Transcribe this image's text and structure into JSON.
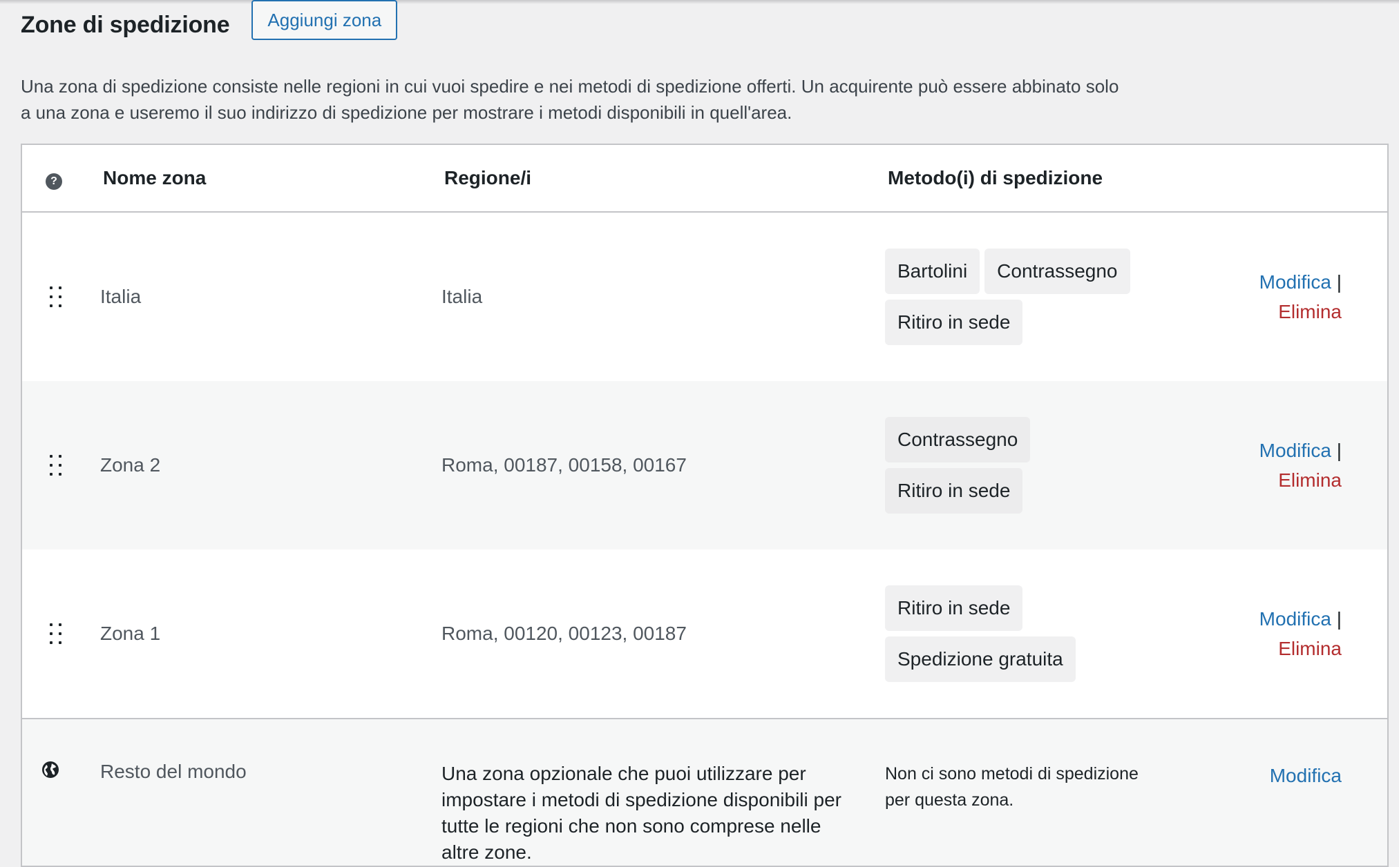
{
  "header": {
    "title": "Zone di spedizione",
    "add_zone_label": "Aggiungi zona"
  },
  "description": "Una zona di spedizione consiste nelle regioni in cui vuoi spedire e nei metodi di spedizione offerti. Un acquirente può essere abbinato solo a una zona e useremo il suo indirizzo di spedizione per mostrare i metodi disponibili in quell'area.",
  "table": {
    "help_icon": "?",
    "columns": {
      "name": "Nome zona",
      "regions": "Regione/i",
      "methods": "Metodo(i) di spedizione"
    },
    "rows": [
      {
        "name": "Italia",
        "regions": "Italia",
        "methods": [
          "Bartolini",
          "Contrassegno",
          "Ritiro in sede"
        ],
        "edit_label": "Modifica",
        "separator": "|",
        "delete_label": "Elimina"
      },
      {
        "name": "Zona 2",
        "regions": "Roma, 00187, 00158, 00167",
        "methods": [
          "Contrassegno",
          "Ritiro in sede"
        ],
        "edit_label": "Modifica",
        "separator": "|",
        "delete_label": "Elimina"
      },
      {
        "name": "Zona 1",
        "regions": "Roma, 00120, 00123, 00187",
        "methods": [
          "Ritiro in sede",
          "Spedizione gratuita"
        ],
        "edit_label": "Modifica",
        "separator": "|",
        "delete_label": "Elimina"
      }
    ],
    "rest_of_world": {
      "name": "Resto del mondo",
      "description": "Una zona opzionale che puoi utilizzare per impostare i metodi di spedizione disponibili per tutte le regioni che non sono comprese nelle altre zone.",
      "methods_text": "Non ci sono metodi di spedizione per questa zona.",
      "edit_label": "Modifica"
    }
  },
  "icons": {
    "drag": "drag-handle-icon",
    "help": "help-icon",
    "globe": "globe-icon"
  },
  "colors": {
    "link": "#2271b1",
    "delete": "#b32d2e",
    "background": "#f0f0f1"
  }
}
